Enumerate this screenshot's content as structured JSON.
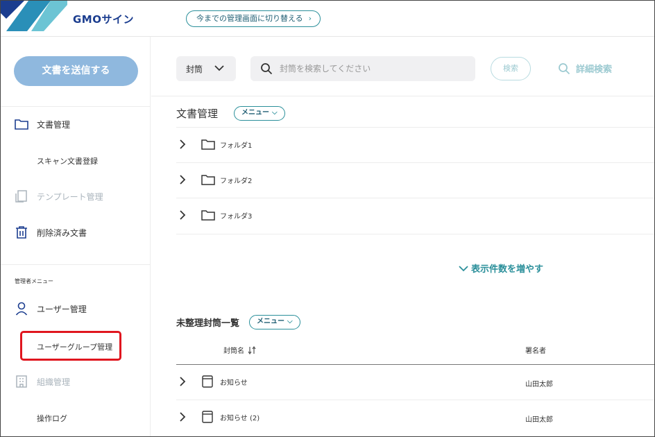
{
  "header": {
    "brand": "GMOサイン",
    "old_ui_button": "今までの管理画面に切り替える",
    "chevron_right": "›"
  },
  "sidebar": {
    "send_button": "文書を送信する",
    "items": [
      {
        "label": "文書管理",
        "icon": "folder-icon"
      },
      {
        "label": "スキャン文書登録"
      },
      {
        "label": "テンプレート管理",
        "icon": "template-icon",
        "disabled": true
      },
      {
        "label": "削除済み文書",
        "icon": "trash-icon"
      }
    ],
    "admin_label": "管理者メニュー",
    "admin_items": [
      {
        "label": "ユーザー管理",
        "icon": "user-icon"
      },
      {
        "label": "ユーザーグループ管理"
      },
      {
        "label": "組織管理",
        "icon": "building-icon",
        "disabled": true
      },
      {
        "label": "操作ログ"
      }
    ],
    "highlight_color": "#e0161f"
  },
  "search": {
    "type_select": "封筒",
    "placeholder": "封筒を検索してください",
    "search_button": "検索",
    "advanced_search": "詳細検索"
  },
  "documents": {
    "title": "文書管理",
    "menu_label": "メニュー",
    "folders": [
      "フォルダ1",
      "フォルダ2",
      "フォルダ3"
    ],
    "show_more": "表示件数を増やす"
  },
  "unsorted": {
    "title": "未整理封筒一覧",
    "menu_label": "メニュー",
    "columns": {
      "name": "封筒名",
      "signer": "署名者"
    },
    "rows": [
      {
        "name": "お知らせ",
        "signer": "山田太郎"
      },
      {
        "name": "お知らせ (2)",
        "signer": "山田太郎"
      }
    ]
  },
  "colors": {
    "accent": "#2a8f9a",
    "primary_button": "#8fb8de",
    "brand": "#1b3d8f"
  }
}
